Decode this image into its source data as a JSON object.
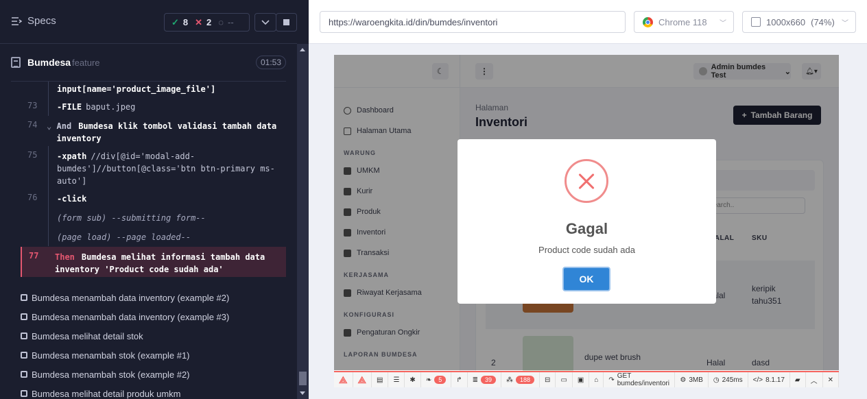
{
  "reporter": {
    "specs_label": "Specs",
    "stats": {
      "passed": "8",
      "failed": "2",
      "pending": "--"
    },
    "spec": {
      "name": "Bumdesa",
      "ext": "feature",
      "time": "01:53"
    },
    "commands": [
      {
        "num": "",
        "type": "text",
        "text": "input[name='product_image_file']"
      },
      {
        "num": "73",
        "type": "cmd",
        "cmd": "-FILE",
        "arg": "baput.jpeg"
      },
      {
        "num": "74",
        "type": "gherkin",
        "kw": "And",
        "text": "Bumdesa klik tombol validasi tambah data inventory"
      },
      {
        "num": "75",
        "type": "xpath",
        "cmd": "-xpath",
        "arg": "//div[@id='modal-add-bumdes']//button[@class='btn btn-primary ms-auto']"
      },
      {
        "num": "76",
        "type": "cmd",
        "cmd": "-click",
        "arg": ""
      },
      {
        "num": "",
        "type": "italic",
        "text": "(form sub)  --submitting form--"
      },
      {
        "num": "",
        "type": "italic",
        "text": "(page load)  --page loaded--"
      }
    ],
    "failing": {
      "num": "77",
      "kw": "Then",
      "text": "Bumdesa melihat informasi tambah data inventory 'Product code sudah ada'"
    },
    "tests": [
      "Bumdesa menambah data inventory (example #2)",
      "Bumdesa menambah data inventory (example #3)",
      "Bumdesa melihat detail stok",
      "Bumdesa menambah stok (example #1)",
      "Bumdesa menambah stok (example #2)",
      "Bumdesa melihat detail produk umkm"
    ]
  },
  "aut": {
    "url": "https://waroengkita.id/din/bumdes/inventori",
    "browser": "Chrome 118",
    "viewport": "1000x660",
    "zoom": "(74%)"
  },
  "app": {
    "sidebar": {
      "items": [
        {
          "label": "Dashboard",
          "icon": "dashboard-icon"
        },
        {
          "label": "Halaman Utama",
          "icon": "home-icon"
        }
      ],
      "sections": [
        {
          "title": "WARUNG",
          "items": [
            "UMKM",
            "Kurir",
            "Produk",
            "Inventori",
            "Transaksi"
          ]
        },
        {
          "title": "KERJASAMA",
          "items": [
            "Riwayat Kerjasama"
          ]
        },
        {
          "title": "KONFIGURASI",
          "items": [
            "Pengaturan Ongkir"
          ]
        },
        {
          "title": "LAPORAN BUMDESA",
          "items": []
        }
      ]
    },
    "topbar": {
      "user": "Admin bumdes Test"
    },
    "page": {
      "pretitle": "Halaman",
      "title": "Inventori",
      "add_button": "Tambah Barang",
      "search_placeholder": "Search.."
    },
    "table": {
      "headers": [
        "HALAL",
        "SKU"
      ],
      "rows": [
        {
          "no": "",
          "name": "",
          "halal": "Halal",
          "sku": "keripik tahu351"
        },
        {
          "no": "2",
          "name": "dupe wet brush",
          "halal": "Halal",
          "sku": "dasd"
        }
      ]
    },
    "modal": {
      "title": "Gagal",
      "message": "Product code sudah ada",
      "ok": "OK"
    },
    "debugbar": {
      "badges": [
        "5",
        "39",
        "188"
      ],
      "request": "GET bumdes/inventori",
      "memory": "3MB",
      "time": "245ms",
      "version": "8.1.17"
    }
  },
  "colors": {
    "pass": "#1fa971",
    "fail": "#e45770",
    "ok_button": "#3085d6",
    "debug_red": "#f4645f"
  }
}
